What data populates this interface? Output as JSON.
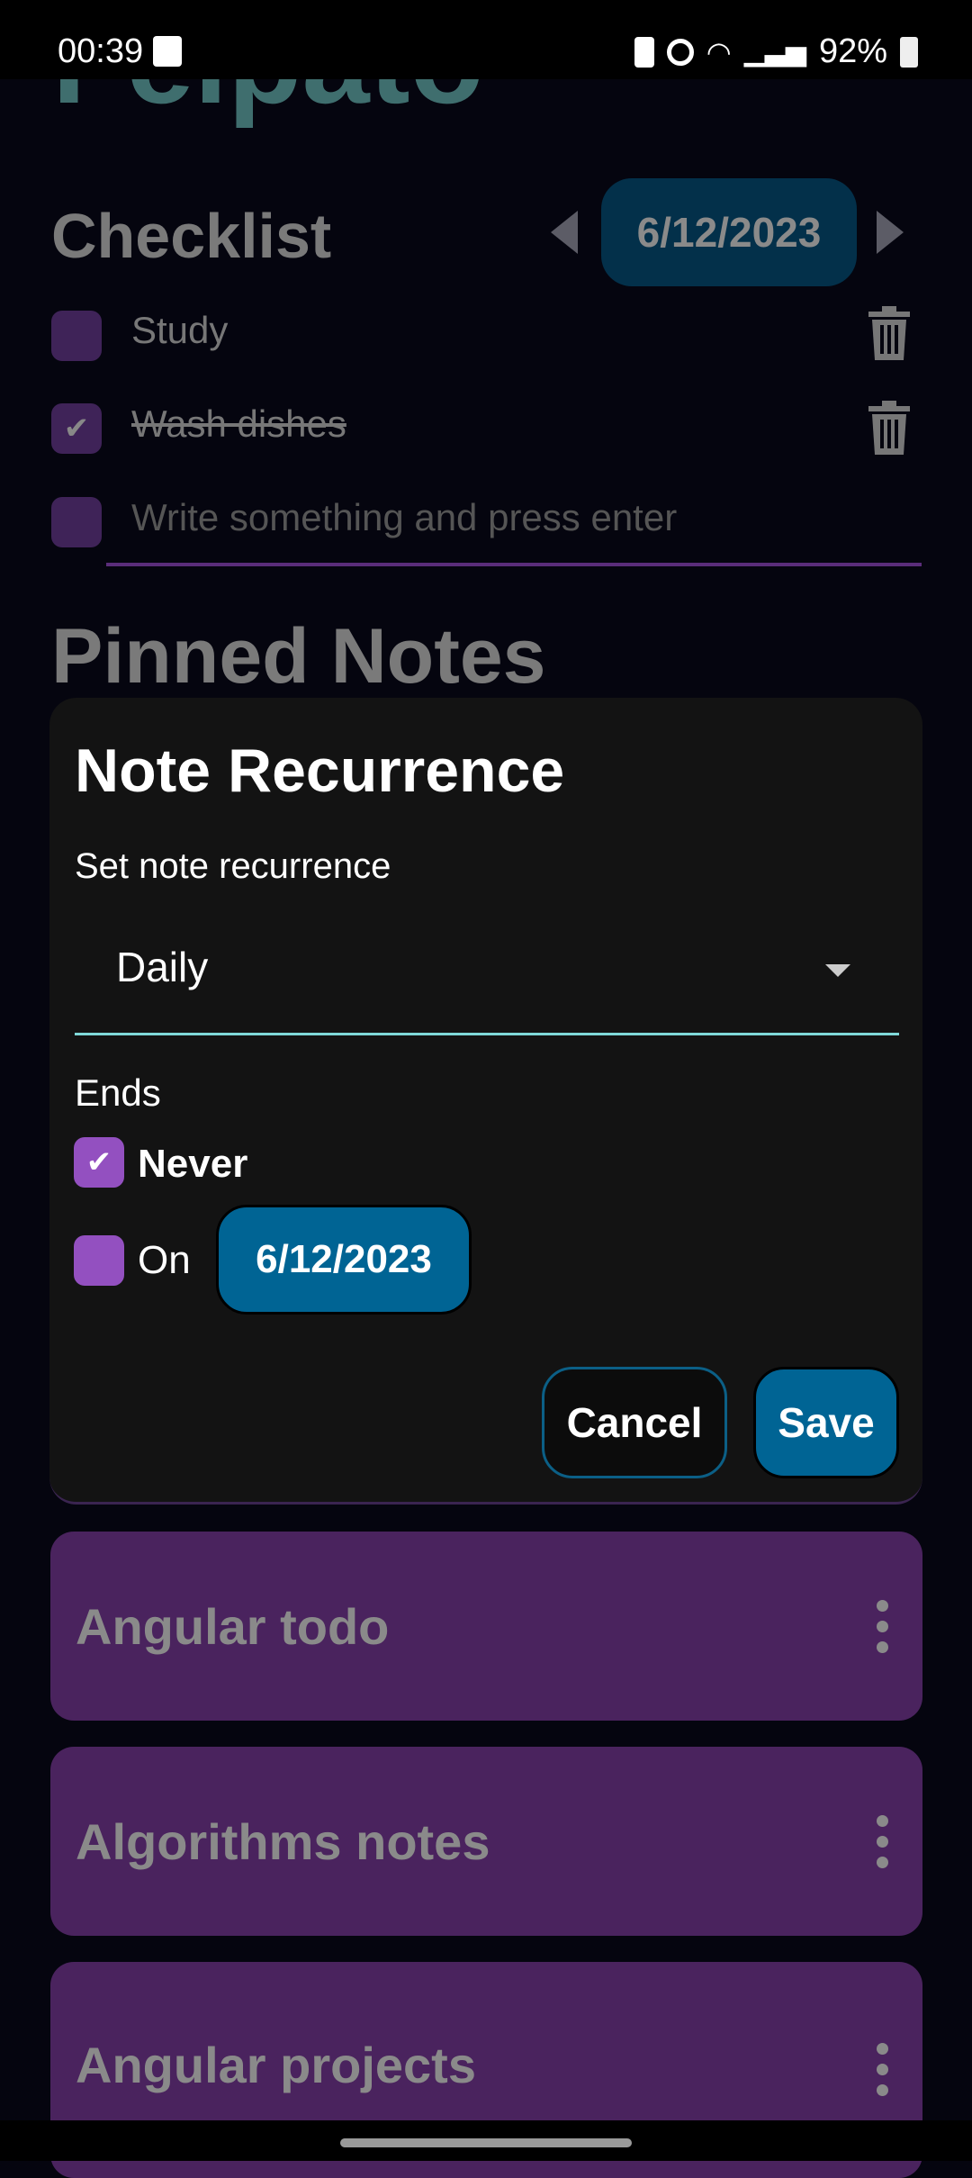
{
  "status": {
    "time": "00:39",
    "battery": "92%"
  },
  "app": {
    "title": "Felpato"
  },
  "checklist": {
    "heading": "Checklist",
    "date": "6/12/2023",
    "items": [
      {
        "label": "Study",
        "checked": false
      },
      {
        "label": "Wash dishes",
        "checked": true
      }
    ],
    "input_placeholder": "Write something and press enter"
  },
  "pinned": {
    "heading": "Pinned Notes",
    "notes": [
      {
        "title": "Angular todo"
      },
      {
        "title": "Algorithms notes"
      },
      {
        "title": "Angular projects"
      }
    ]
  },
  "dialog": {
    "title": "Note Recurrence",
    "label": "Set note recurrence",
    "selected": "Daily",
    "ends_label": "Ends",
    "never_label": "Never",
    "never_checked": true,
    "on_label": "On",
    "on_checked": false,
    "on_date": "6/12/2023",
    "cancel": "Cancel",
    "save": "Save"
  },
  "colors": {
    "accent": "#006494",
    "checkbox": "#9350c0",
    "card": "#4a235e",
    "select_underline": "#7fd8d8"
  }
}
